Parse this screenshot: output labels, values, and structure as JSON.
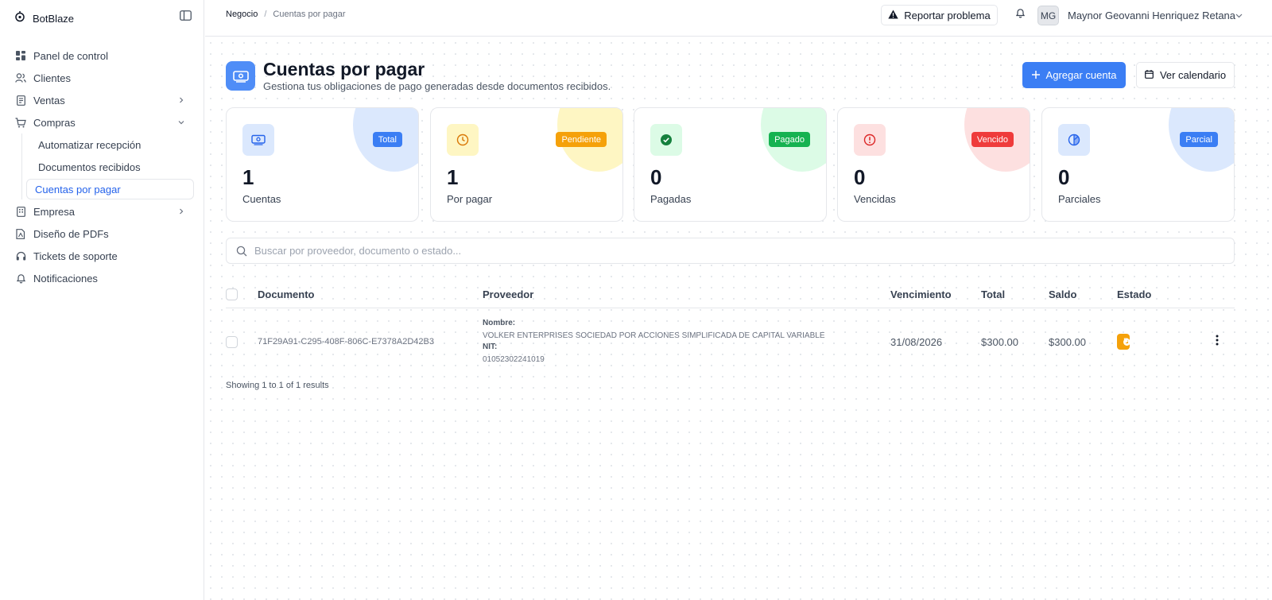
{
  "app": {
    "name": "BotBlaze"
  },
  "sidebar": {
    "items": [
      {
        "label": "Panel de control",
        "icon": "dashboard-icon"
      },
      {
        "label": "Clientes",
        "icon": "users-icon"
      },
      {
        "label": "Ventas",
        "icon": "receipt-icon",
        "expandable": true
      },
      {
        "label": "Compras",
        "icon": "cart-icon",
        "expanded": true,
        "children": [
          {
            "label": "Automatizar recepción"
          },
          {
            "label": "Documentos recibidos"
          },
          {
            "label": "Cuentas por pagar",
            "active": true
          }
        ]
      },
      {
        "label": "Empresa",
        "icon": "building-icon",
        "expandable": true
      },
      {
        "label": "Diseño de PDFs",
        "icon": "pdf-design-icon"
      },
      {
        "label": "Tickets de soporte",
        "icon": "headset-icon"
      },
      {
        "label": "Notificaciones",
        "icon": "bell-icon"
      }
    ]
  },
  "header": {
    "breadcrumb": [
      "Negocio",
      "Cuentas por pagar"
    ],
    "report_label": "Reportar problema",
    "user_initials": "MG",
    "user_name": "Maynor Geovanni Henriquez Retana"
  },
  "page": {
    "title": "Cuentas por pagar",
    "subtitle": "Gestiona tus obligaciones de pago generadas desde documentos recibidos.",
    "add_button": "Agregar cuenta",
    "calendar_button": "Ver calendario"
  },
  "cards": [
    {
      "badge": "Total",
      "value": "1",
      "label": "Cuentas",
      "color": "#3b7ef4",
      "tint": "#dbe8fd",
      "icon": "money-icon"
    },
    {
      "badge": "Pendiente",
      "value": "1",
      "label": "Por pagar",
      "color": "#f5a10a",
      "tint": "#fef6c3",
      "icon": "clock-icon"
    },
    {
      "badge": "Pagado",
      "value": "0",
      "label": "Pagadas",
      "color": "#16b251",
      "tint": "#dcfbe6",
      "icon": "check-circle-icon"
    },
    {
      "badge": "Vencido",
      "value": "0",
      "label": "Vencidas",
      "color": "#ef3b3b",
      "tint": "#fde0e0",
      "icon": "alert-circle-icon"
    },
    {
      "badge": "Parcial",
      "value": "0",
      "label": "Parciales",
      "color": "#3b7ef4",
      "tint": "#dbe8fd",
      "icon": "partial-circle-icon"
    }
  ],
  "search": {
    "placeholder": "Buscar por proveedor, documento o estado..."
  },
  "table": {
    "columns": [
      "Documento",
      "Proveedor",
      "Vencimiento",
      "Total",
      "Saldo",
      "Estado"
    ],
    "rows": [
      {
        "documento": "71F29A91-C295-408F-806C-E7378A2D42B3",
        "nombre_label": "Nombre:",
        "nombre": "VOLKER ENTERPRISES SOCIEDAD POR ACCIONES SIMPLIFICADA DE CAPITAL VARIABLE",
        "nit_label": "NIT:",
        "nit": "01052302241019",
        "vencimiento": "31/08/2026",
        "total": "$300.00",
        "saldo": "$300.00",
        "estado": "Pendiente"
      }
    ],
    "results_text": "Showing 1 to 1 of 1 results"
  }
}
